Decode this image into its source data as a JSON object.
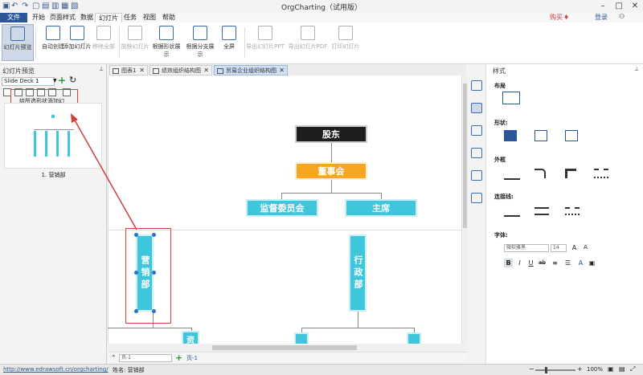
{
  "app": {
    "title": "OrgCharting（试用版）"
  },
  "menu": {
    "file": "文件",
    "items": [
      "开始",
      "页面样式",
      "数据",
      "幻灯片",
      "任务",
      "视图",
      "帮助"
    ],
    "buy": "购买",
    "login": "登录"
  },
  "ribbon": {
    "buttons": [
      "幻灯片预览",
      "自动创建",
      "添加幻灯片",
      "移除全部",
      "放映幻灯片",
      "根据形状展示",
      "根据分支展示",
      "全屏",
      "导出幻灯片PPT",
      "导出幻灯片PDF",
      "打印幻灯片"
    ]
  },
  "left_panel": {
    "title": "幻灯片预览",
    "deck": "Slide Deck 1",
    "tooltip": "给所选形状添加幻灯片页面",
    "thumb_caption": "1. 营销部"
  },
  "tabs": [
    "图表1",
    "绩效组织结构图",
    "贸易企业组织结构图"
  ],
  "chart": {
    "top": "股东",
    "board": "董事会",
    "committee": "监督委员会",
    "chair": "主席",
    "marketing": "营销部",
    "admin": "行政部",
    "partial": "资"
  },
  "right_panel": {
    "title": "样式",
    "layout": "布局",
    "shape": "形状:",
    "border": "外框",
    "connector": "连接线:",
    "font": "字体:",
    "font_name": "微软雅黑",
    "font_size": "14"
  },
  "page_bar": {
    "select": "页-1",
    "page": "页-1"
  },
  "status": {
    "url": "http://www.edrawsoft.cn/orgcharting/",
    "name": "姓名: 营销部",
    "zoom": "100%"
  },
  "colors": {
    "accent": "#2b579a",
    "cyan": "#3fc5dc",
    "orange": "#f5a623",
    "annotation": "#d04040"
  }
}
